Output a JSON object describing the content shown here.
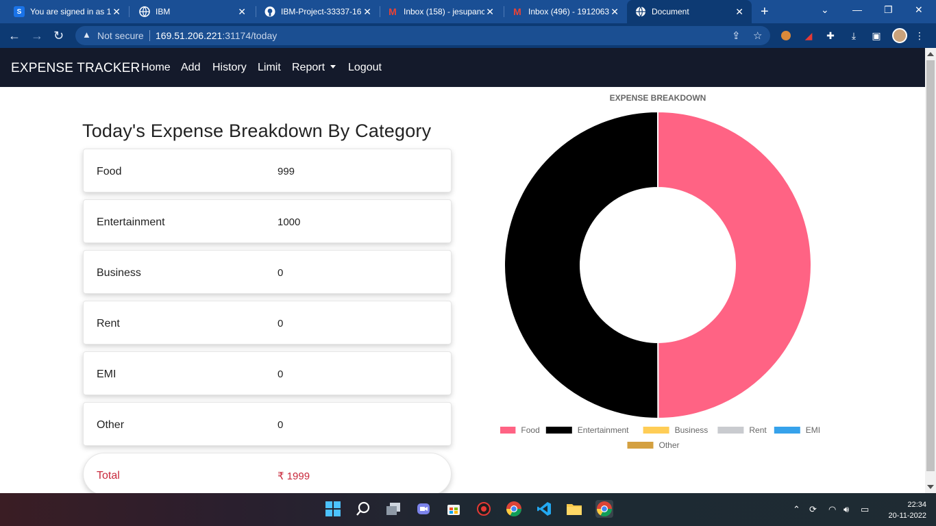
{
  "browser": {
    "tabs": [
      {
        "title": "You are signed in as 1!",
        "icon": "s-icon",
        "fav_text": "S",
        "fav_color": "#1a73e8"
      },
      {
        "title": "IBM",
        "icon": "globe-icon",
        "fav_text": "",
        "fav_color": "#ffffff"
      },
      {
        "title": "IBM-Project-33337-16",
        "icon": "github-icon",
        "fav_text": "",
        "fav_color": "#ffffff"
      },
      {
        "title": "Inbox (158) - jesupanc",
        "icon": "gmail-icon",
        "fav_text": "M",
        "fav_color": "#ea4335"
      },
      {
        "title": "Inbox (496) - 1912063",
        "icon": "gmail-icon",
        "fav_text": "M",
        "fav_color": "#ea4335"
      },
      {
        "title": "Document",
        "icon": "globe-icon",
        "fav_text": "",
        "fav_color": "#ffffff"
      }
    ],
    "security": "Not secure",
    "url_host": "169.51.206.221",
    "url_rest": ":31174/today"
  },
  "navbar": {
    "brand": "EXPENSE TRACKER",
    "links": [
      "Home",
      "Add",
      "History",
      "Limit",
      "Report",
      "Logout"
    ]
  },
  "page": {
    "title": "Today's Expense Breakdown By Category",
    "rows": [
      {
        "category": "Food",
        "amount": "999"
      },
      {
        "category": "Entertainment",
        "amount": "1000"
      },
      {
        "category": "Business",
        "amount": "0"
      },
      {
        "category": "Rent",
        "amount": "0"
      },
      {
        "category": "EMI",
        "amount": "0"
      },
      {
        "category": "Other",
        "amount": "0"
      }
    ],
    "total": {
      "label": "Total",
      "amount": "₹ 1999"
    },
    "accent_color": "#c8283b"
  },
  "chart_data": {
    "type": "doughnut",
    "title": "EXPENSE BREAKDOWN",
    "categories": [
      "Food",
      "Entertainment",
      "Business",
      "Rent",
      "EMI",
      "Other"
    ],
    "values": [
      999,
      1000,
      0,
      0,
      0,
      0
    ],
    "colors": [
      "#ff6384",
      "#000000",
      "#ffcd56",
      "#c9cbcf",
      "#36a2eb",
      "#d4a040"
    ],
    "legend_position": "bottom"
  },
  "taskbar": {
    "time": "22:34",
    "date": "20-11-2022"
  }
}
